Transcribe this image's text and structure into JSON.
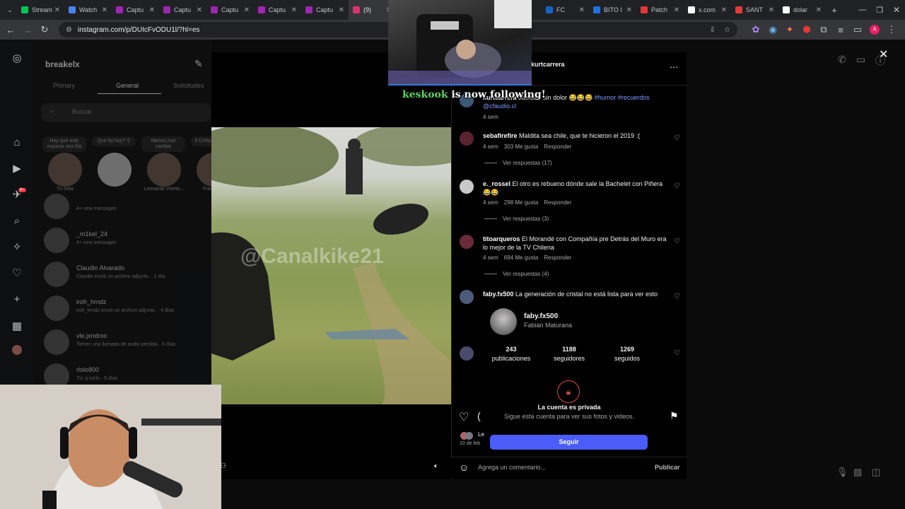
{
  "browser": {
    "tabs": [
      {
        "label": "Stream",
        "icon": "stream-icon",
        "color": "#00c853"
      },
      {
        "label": "Watch",
        "icon": "watch-icon",
        "color": "#4285f4"
      },
      {
        "label": "Captu",
        "icon": "capture-icon",
        "color": "#9c27b0"
      },
      {
        "label": "Captu",
        "icon": "capture-icon",
        "color": "#9c27b0"
      },
      {
        "label": "Captu",
        "icon": "capture-icon",
        "color": "#9c27b0"
      },
      {
        "label": "Captu",
        "icon": "capture-icon",
        "color": "#9c27b0"
      },
      {
        "label": "Captu",
        "icon": "capture-icon",
        "color": "#9c27b0"
      },
      {
        "label": "(9) ",
        "icon": "instagram-icon",
        "color": "#e1306c"
      }
    ],
    "tabs_right": [
      {
        "label": "FC",
        "icon": "fc-icon",
        "color": "#1565c0"
      },
      {
        "label": "BITO I",
        "icon": "bito-icon",
        "color": "#1a73e8"
      },
      {
        "label": "Patch",
        "icon": "patch-icon",
        "color": "#e53935"
      },
      {
        "label": "x.com",
        "icon": "x-icon",
        "color": "#ffffff"
      },
      {
        "label": "SANT",
        "icon": "santander-icon",
        "color": "#e53935"
      },
      {
        "label": "dolar",
        "icon": "google-icon",
        "color": "#ffffff"
      }
    ],
    "new_tab": "+",
    "url": "instagram.com/p/DUIcFvODU1l/?hl=es"
  },
  "dm": {
    "username": "breakelx",
    "tabs": [
      "Primary",
      "General",
      "Solicitudes"
    ],
    "search_placeholder": "Buscar",
    "notes": [
      "Hay que este espacio sea fifa",
      "Que fai hoy? ⚲",
      "Menos mal cambie",
      "Il CHAL Justin C"
    ],
    "note_names": [
      "Tu nota",
      "",
      "Leonardo Vivero...",
      "Francisco"
    ],
    "threads": [
      {
        "name": "",
        "sub": "4+ new messages"
      },
      {
        "name": "_m1kel_24",
        "sub": "4+ new messages"
      },
      {
        "name": "Claudio Alvarado",
        "sub": "Claudio envió un archivo adjunto. · 1 día"
      },
      {
        "name": "iroh_hrndz",
        "sub": "iroh_hrndz envió un archivo adjunto. · 4 días"
      },
      {
        "name": "vle.jxndroo",
        "sub": "Tienes una llamada de audio perdida · 5 días"
      },
      {
        "name": "rlolo800",
        "sub": "Tú: q corlo · 5 días"
      }
    ],
    "rail_badge": "9+"
  },
  "post": {
    "author": "kurtcarrera",
    "watermark": "@Canalkike21",
    "caption_user": "kurtcarrera",
    "caption_text": "Jackass sin dolor 😂😂😂",
    "caption_tags": "#humor #recuerdos",
    "caption_mention": "@cfaudio.cl",
    "caption_time": "4 sem",
    "comments": [
      {
        "user": "sebafirefire",
        "text": "Maldita sea chile, que te hicieron el 2019 :(",
        "time": "4 sem",
        "likes": "303 Me gusta",
        "reply": "Responder",
        "replies": "Ver respuestas (17)"
      },
      {
        "user": "e._rossel",
        "text": "El otro es rebueno dónde sale la Bachelet con Piñera 😂😂",
        "time": "4 sem",
        "likes": "298 Me gusta",
        "reply": "Responder",
        "replies": "Ver respuestas (3)"
      },
      {
        "user": "titoarqueros",
        "text": "El Morandé con Compañía pre Detrás del Muro era lo mejor de la TV Chilena",
        "time": "4 sem",
        "likes": "694 Me gusta",
        "reply": "Responder",
        "replies": "Ver respuestas (4)"
      },
      {
        "user": "faby.fx500",
        "text": "La generación de cristal no está lista para ver esto",
        "time": "",
        "likes": "",
        "reply": "",
        "replies": ""
      }
    ],
    "date": "10 de feb",
    "likes_prefix": "Le",
    "comment_placeholder": "Agrega un comentario...",
    "publish": "Publicar"
  },
  "hovercard": {
    "username": "faby.fx500",
    "fullname": "Fabián Maturana",
    "stats": [
      {
        "value": "243",
        "label": "publicaciones"
      },
      {
        "value": "1188",
        "label": "seguidores"
      },
      {
        "value": "1269",
        "label": "seguidos"
      }
    ],
    "private_title": "La cuenta es privada",
    "private_sub": "Sigue esta cuenta para ver sus fotos y videos.",
    "follow": "Seguir"
  },
  "overlay": {
    "follower": "keskook",
    "follow_msg": "is now following!",
    "follower_color": "#5fd35f"
  }
}
